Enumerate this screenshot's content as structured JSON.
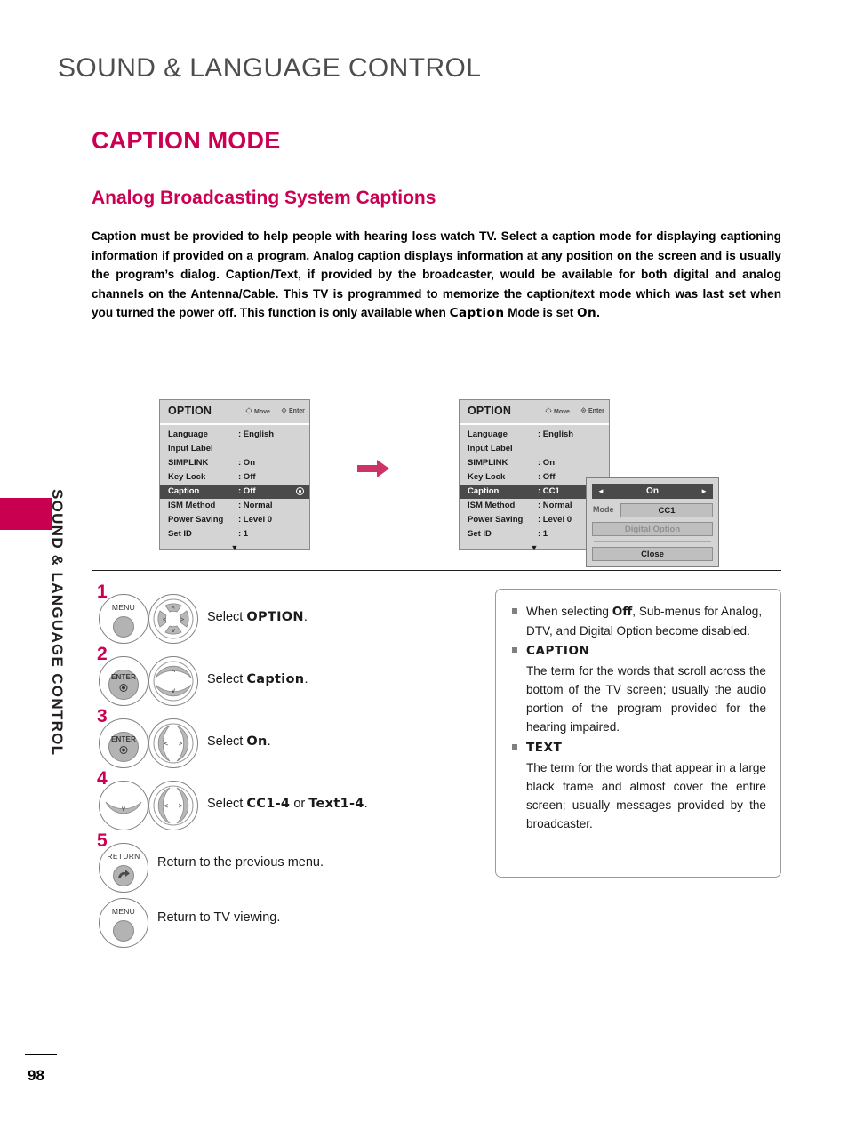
{
  "page": {
    "running_head": "SOUND & LANGUAGE CONTROL",
    "chapter_tab_label": "SOUND & LANGUAGE CONTROL",
    "page_number": "98",
    "accent_color": "#CC0052"
  },
  "headings": {
    "h1": "CAPTION MODE",
    "h2": "Analog Broadcasting System Captions"
  },
  "intro": {
    "text_part_1": "Caption must be provided to help people with hearing loss watch TV. Select a caption mode for displaying captioning information if provided on a program. Analog caption displays information at any position on the screen and is usually the program’s dialog. Caption/Text, if provided by the broadcaster, would be available for both digital and analog channels on the Antenna/Cable. This TV is programmed to memorize the caption/text mode which was last set when you turned the power off. This function is only available when ",
    "emphasis_1": "Caption",
    "text_part_2": " Mode is set ",
    "emphasis_2": "On",
    "text_part_3": "."
  },
  "osd_panel_1": {
    "title": "OPTION",
    "hint_move": "Move",
    "hint_enter": "Enter",
    "down_arrow": "▼",
    "rows": [
      {
        "label": "Language",
        "value": ": English",
        "selected": false
      },
      {
        "label": "Input Label",
        "value": "",
        "selected": false
      },
      {
        "label": "SIMPLINK",
        "value": ": On",
        "selected": false
      },
      {
        "label": "Key Lock",
        "value": ": Off",
        "selected": false
      },
      {
        "label": "Caption",
        "value": ": Off",
        "selected": true
      },
      {
        "label": "ISM Method",
        "value": ": Normal",
        "selected": false
      },
      {
        "label": "Power Saving",
        "value": ": Level 0",
        "selected": false
      },
      {
        "label": "Set ID",
        "value": ": 1",
        "selected": false
      }
    ]
  },
  "osd_panel_2": {
    "title": "OPTION",
    "hint_move": "Move",
    "hint_enter": "Enter",
    "down_arrow": "▼",
    "rows": [
      {
        "label": "Language",
        "value": ": English",
        "selected": false
      },
      {
        "label": "Input Label",
        "value": "",
        "selected": false
      },
      {
        "label": "SIMPLINK",
        "value": ": On",
        "selected": false
      },
      {
        "label": "Key Lock",
        "value": ": Off",
        "selected": false
      },
      {
        "label": "Caption",
        "value": ": CC1",
        "selected": true
      },
      {
        "label": "ISM Method",
        "value": ": Normal",
        "selected": false
      },
      {
        "label": "Power Saving",
        "value": ": Level 0",
        "selected": false
      },
      {
        "label": "Set ID",
        "value": ": 1",
        "selected": false
      }
    ]
  },
  "caption_submenu": {
    "onoff_value": "On",
    "arrow_left": "◄",
    "arrow_right": "►",
    "mode_label": "Mode",
    "mode_value": "CC1",
    "digital_option_label": "Digital Option",
    "close_label": "Close"
  },
  "steps": [
    {
      "number": "1",
      "button_label": "MENU",
      "button_type": "plain",
      "pad_type": "four-way",
      "instruction_prefix": "Select ",
      "instruction_emphasis": "OPTION",
      "instruction_suffix": "."
    },
    {
      "number": "2",
      "button_label": "ENTER",
      "button_type": "enter",
      "pad_type": "up-down",
      "instruction_prefix": "Select ",
      "instruction_emphasis": "Caption",
      "instruction_suffix": "."
    },
    {
      "number": "3",
      "button_label": "ENTER",
      "button_type": "enter",
      "pad_type": "left-right",
      "instruction_prefix": "Select ",
      "instruction_emphasis": "On",
      "instruction_suffix": "."
    },
    {
      "number": "4",
      "button_label": "",
      "button_type": "down-only",
      "pad_type": "left-right",
      "instruction_prefix": "Select ",
      "instruction_emphasis": "CC1-4",
      "instruction_middle": " or ",
      "instruction_emphasis_2": "Text1-4",
      "instruction_suffix": "."
    }
  ],
  "tail_steps": [
    {
      "number": "5",
      "button_label": "RETURN",
      "instruction": "Return to the previous menu."
    },
    {
      "number": "",
      "button_label": "MENU",
      "instruction": "Return to TV viewing."
    }
  ],
  "notes": [
    {
      "kind": "plain",
      "prefix": "When selecting ",
      "emphasis": "Off",
      "suffix": ", Sub-menus for Analog, DTV, and Digital Option become disabled."
    },
    {
      "kind": "headed",
      "heading": "CAPTION",
      "body": "The term for the words that scroll across the bottom of the TV screen; usually the audio portion of the program provided for the hearing impaired."
    },
    {
      "kind": "headed",
      "heading": "TEXT",
      "body": "The term for the words that appear in a large black frame and almost cover the entire screen; usually messages provided by the broadcaster."
    }
  ]
}
